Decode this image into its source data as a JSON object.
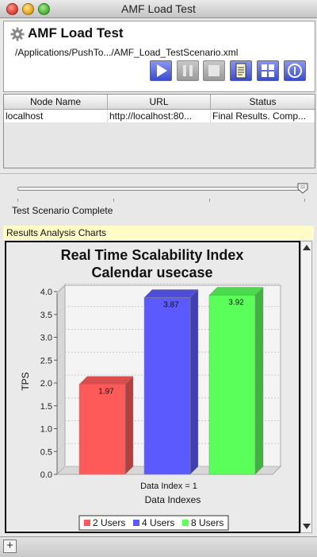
{
  "window": {
    "title": "AMF Load Test"
  },
  "header": {
    "title": "AMF Load Test",
    "path": "/Applications/PushTo.../AMF_Load_TestScenario.xml",
    "toolbar": [
      {
        "name": "play",
        "enabled": true
      },
      {
        "name": "pause",
        "enabled": false
      },
      {
        "name": "stop",
        "enabled": false
      },
      {
        "name": "document",
        "enabled": true
      },
      {
        "name": "grid",
        "enabled": true
      },
      {
        "name": "info",
        "enabled": true
      }
    ]
  },
  "table": {
    "columns": [
      "Node Name",
      "URL",
      "Status"
    ],
    "rows": [
      [
        "localhost",
        "http://localhost:80...",
        "Final Results. Comp..."
      ]
    ]
  },
  "progress": {
    "value": 1.0,
    "status_text": "Test Scenario Complete"
  },
  "results_label": "Results Analysis Charts",
  "chart_data": {
    "type": "bar",
    "title": "Real Time Scalability Index",
    "subtitle": "Calendar usecase",
    "xlabel": "Data Indexes",
    "ylabel": "TPS",
    "categories": [
      "Data Index = 1"
    ],
    "series": [
      {
        "name": "2 Users",
        "values": [
          1.97
        ],
        "color": "#ff5a5a"
      },
      {
        "name": "4 Users",
        "values": [
          3.87
        ],
        "color": "#5a5aff"
      },
      {
        "name": "8 Users",
        "values": [
          3.92
        ],
        "color": "#5aff5a"
      }
    ],
    "ylim": [
      0,
      4.0
    ],
    "yticks": [
      "0.0",
      "0.5",
      "1.0",
      "1.5",
      "2.0",
      "2.5",
      "3.0",
      "3.5",
      "4.0"
    ],
    "legend": "bottom",
    "grid": true
  }
}
